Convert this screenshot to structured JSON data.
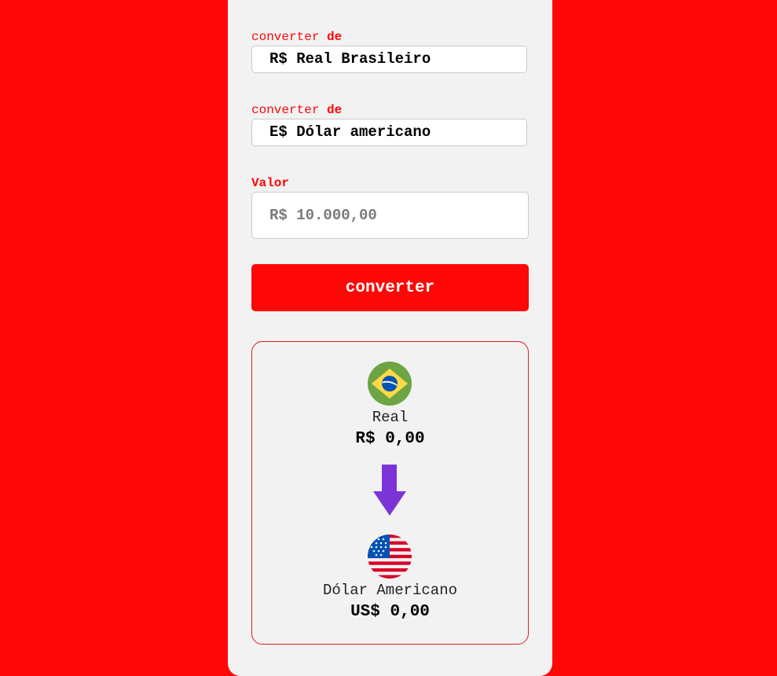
{
  "form": {
    "from": {
      "label_prefix": "converter",
      "label_strong": "de",
      "selected": "R$ Real Brasileiro"
    },
    "to": {
      "label_prefix": "converter",
      "label_strong": "de",
      "selected": "E$ Dólar americano"
    },
    "value": {
      "label": "Valor",
      "placeholder": "R$ 10.000,00"
    },
    "convert_button": "converter"
  },
  "result": {
    "source": {
      "name": "Real",
      "amount": "R$ 0,00",
      "flag_icon": "brazil-flag-icon"
    },
    "target": {
      "name": "Dólar Americano",
      "amount": "US$ 0,00",
      "flag_icon": "usa-flag-icon"
    },
    "arrow_icon": "arrow-down-icon"
  },
  "colors": {
    "background": "#ff0707",
    "card": "#f2f2f2",
    "accent": "#ff0707",
    "arrow": "#7b35d6"
  }
}
